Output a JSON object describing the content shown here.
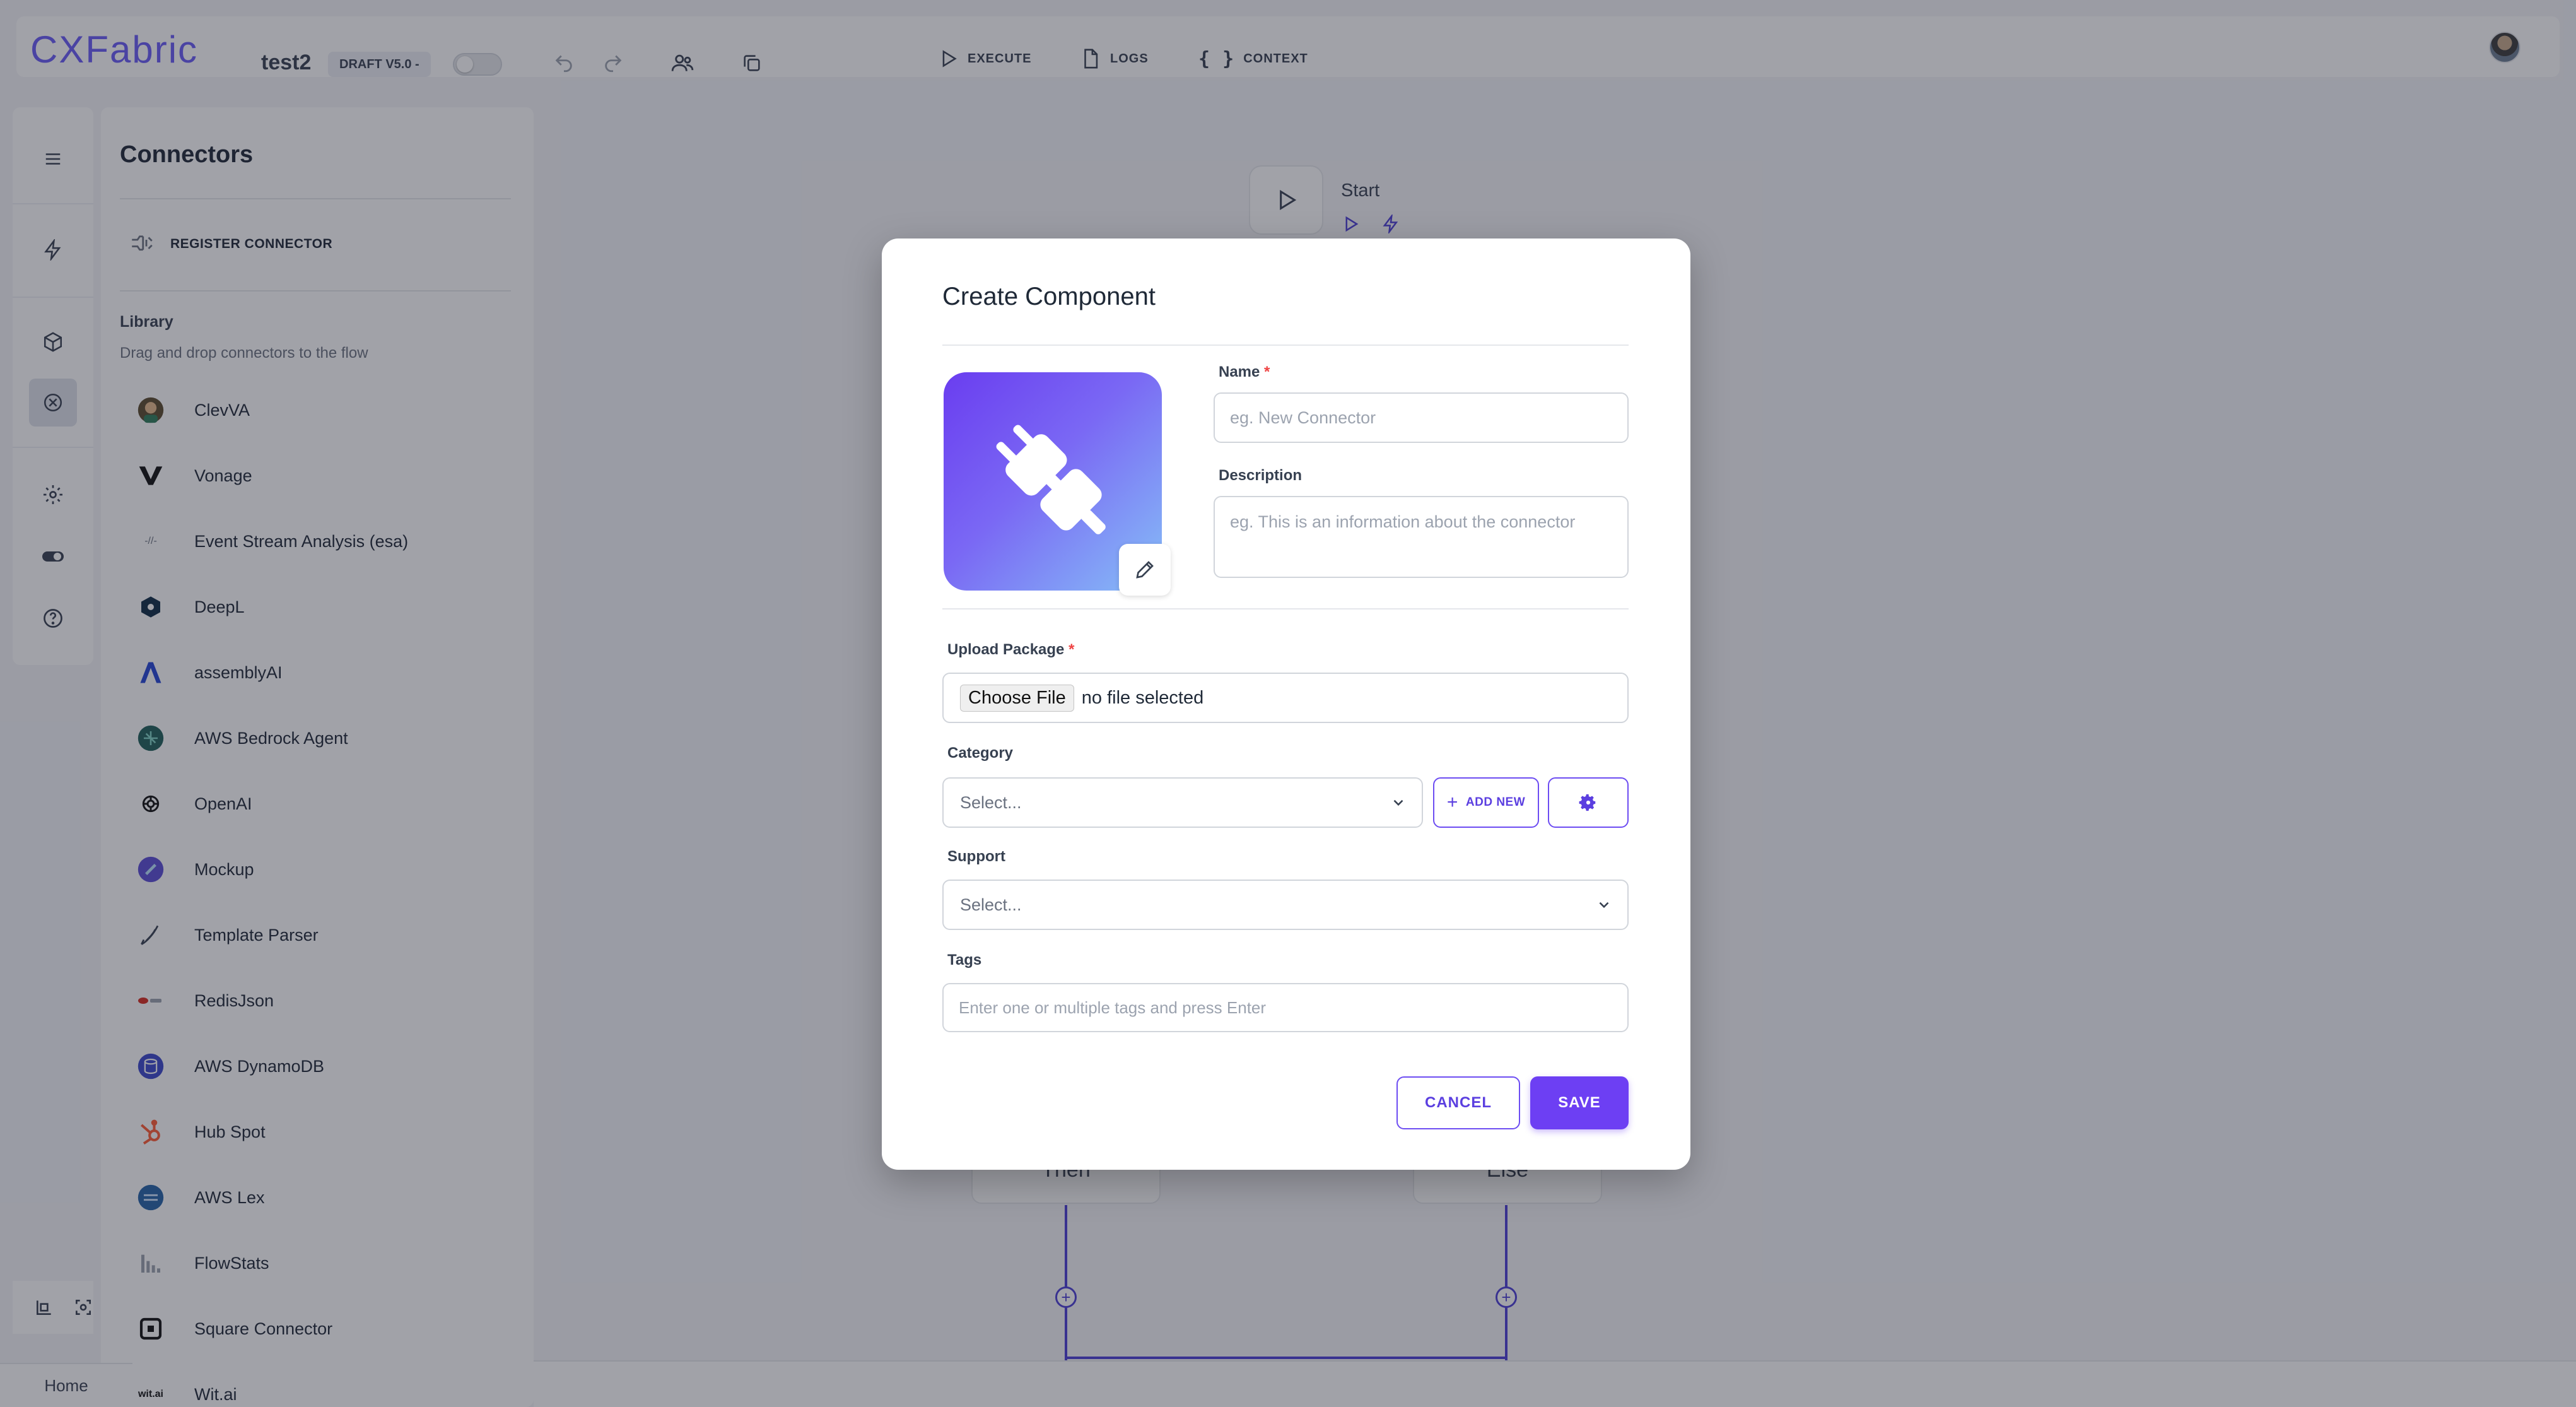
{
  "topbar": {
    "logo": "CXFabric",
    "project": "test2",
    "draft_badge": "DRAFT V5.0 -",
    "actions": [
      {
        "label": "EXECUTE",
        "icon": "play-icon"
      },
      {
        "label": "LOGS",
        "icon": "file-icon"
      },
      {
        "label": "CONTEXT",
        "icon": "braces-icon"
      }
    ]
  },
  "sidebar": {
    "title": "Connectors",
    "register_label": "REGISTER CONNECTOR",
    "library_title": "Library",
    "library_subtitle": "Drag and drop connectors to the flow",
    "items": [
      {
        "label": "ClevVA"
      },
      {
        "label": "Vonage"
      },
      {
        "label": "Event Stream Analysis (esa)"
      },
      {
        "label": "DeepL"
      },
      {
        "label": "assemblyAI"
      },
      {
        "label": "AWS Bedrock Agent"
      },
      {
        "label": "OpenAI"
      },
      {
        "label": "Mockup"
      },
      {
        "label": "Template Parser"
      },
      {
        "label": "RedisJson"
      },
      {
        "label": "AWS DynamoDB"
      },
      {
        "label": "Hub Spot"
      },
      {
        "label": "AWS Lex"
      },
      {
        "label": "FlowStats"
      },
      {
        "label": "Square Connector"
      },
      {
        "label": "Wit.ai"
      }
    ],
    "home_tab": "Home"
  },
  "canvas": {
    "start_label": "Start",
    "then_label": "Then",
    "else_label": "Else"
  },
  "modal": {
    "title": "Create Component",
    "name_label": "Name",
    "name_placeholder": "eg. New Connector",
    "description_label": "Description",
    "description_placeholder": "eg. This is an information about the connector",
    "upload_label": "Upload Package",
    "choose_file": "Choose File",
    "no_file": "no file selected",
    "category_label": "Category",
    "category_value": "Select...",
    "add_new": "ADD NEW",
    "support_label": "Support",
    "support_value": "Select...",
    "tags_label": "Tags",
    "tags_placeholder": "Enter one or multiple tags and press Enter",
    "cancel": "CANCEL",
    "save": "SAVE",
    "required_mark": "*"
  },
  "colors": {
    "accent": "#6d3ff3",
    "flow_line": "#4c3fd6",
    "overlay": "rgba(30,34,48,0.42)"
  }
}
